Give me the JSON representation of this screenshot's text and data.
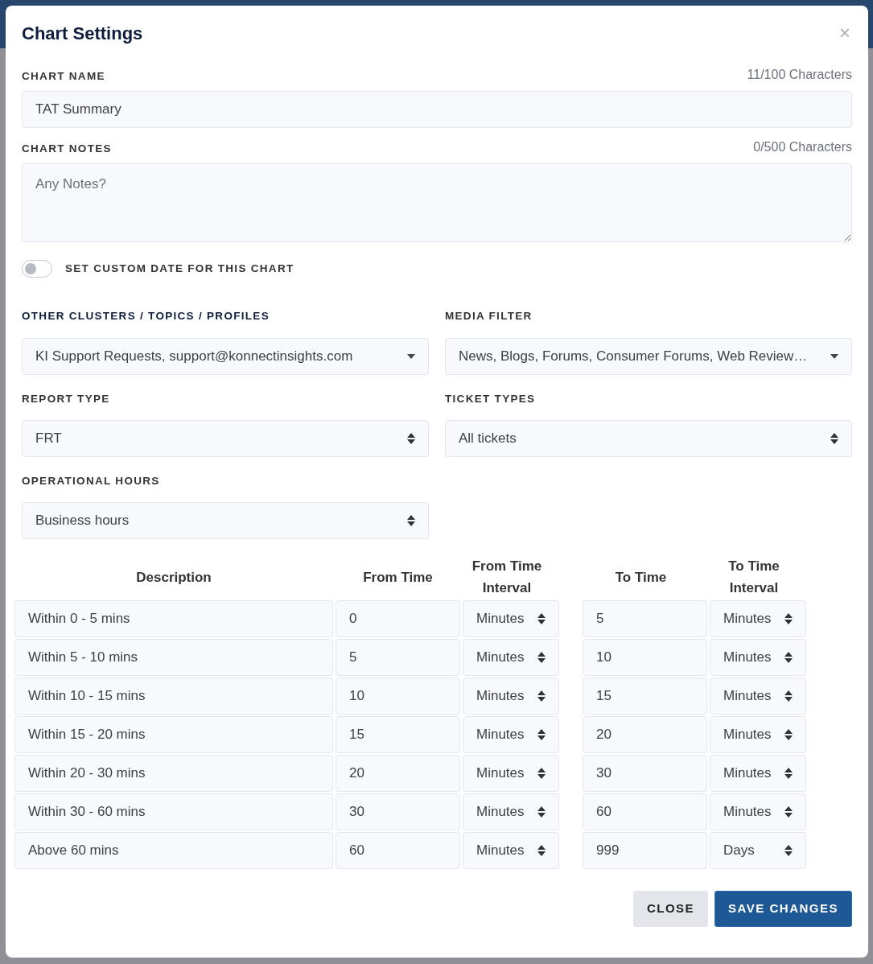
{
  "modal": {
    "title": "Chart Settings",
    "close_glyph": "×"
  },
  "chart_name": {
    "label": "CHART NAME",
    "counter": "11/100 Characters",
    "value": "TAT Summary"
  },
  "chart_notes": {
    "label": "CHART NOTES",
    "counter": "0/500 Characters",
    "placeholder": "Any Notes?"
  },
  "custom_date": {
    "label": "SET CUSTOM DATE FOR THIS CHART",
    "on": false
  },
  "selects": [
    {
      "label": "OTHER CLUSTERS / TOPICS / PROFILES",
      "value": "KI Support Requests, support@konnectinsights.com",
      "kind": "dropdown",
      "highlight": true
    },
    {
      "label": "MEDIA FILTER",
      "value": "News, Blogs, Forums, Consumer Forums, Web Review…",
      "kind": "dropdown",
      "highlight": false
    },
    {
      "label": "REPORT TYPE",
      "value": "FRT",
      "kind": "select",
      "highlight": false
    },
    {
      "label": "TICKET TYPES",
      "value": "All tickets",
      "kind": "select",
      "highlight": false
    },
    {
      "label": "OPERATIONAL HOURS",
      "value": "Business hours",
      "kind": "select",
      "highlight": false
    }
  ],
  "table": {
    "columns": [
      "Description",
      "From Time",
      "From Time Interval",
      "To Time",
      "To Time Interval"
    ],
    "rows": [
      {
        "description": "Within 0 - 5 mins",
        "from": "0",
        "from_interval": "Minutes",
        "to": "5",
        "to_interval": "Minutes"
      },
      {
        "description": "Within 5 - 10 mins",
        "from": "5",
        "from_interval": "Minutes",
        "to": "10",
        "to_interval": "Minutes"
      },
      {
        "description": "Within 10 - 15 mins",
        "from": "10",
        "from_interval": "Minutes",
        "to": "15",
        "to_interval": "Minutes"
      },
      {
        "description": "Within 15 - 20 mins",
        "from": "15",
        "from_interval": "Minutes",
        "to": "20",
        "to_interval": "Minutes"
      },
      {
        "description": "Within 20 - 30 mins",
        "from": "20",
        "from_interval": "Minutes",
        "to": "30",
        "to_interval": "Minutes"
      },
      {
        "description": "Within 30 - 60 mins",
        "from": "30",
        "from_interval": "Minutes",
        "to": "60",
        "to_interval": "Minutes"
      },
      {
        "description": "Above 60 mins",
        "from": "60",
        "from_interval": "Minutes",
        "to": "999",
        "to_interval": "Days"
      }
    ]
  },
  "buttons": [
    {
      "label": "CLOSE",
      "kind": "secondary"
    },
    {
      "label": "SAVE CHANGES",
      "kind": "primary"
    }
  ]
}
